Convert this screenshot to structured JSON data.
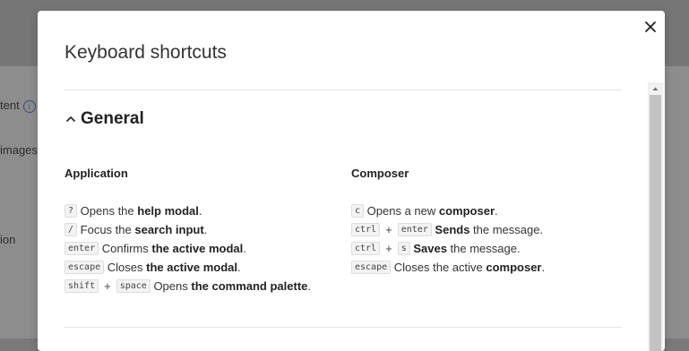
{
  "background": {
    "fragments": [
      "tent",
      "images",
      "ion"
    ]
  },
  "modal": {
    "title": "Keyboard shortcuts",
    "section": {
      "title": "General",
      "expanded": true
    },
    "columns": [
      {
        "title": "Application",
        "shortcuts": [
          {
            "keys": [
              "?"
            ],
            "pre": "Opens the ",
            "bold": "help modal",
            "post": "."
          },
          {
            "keys": [
              "/"
            ],
            "pre": "Focus the ",
            "bold": "search input",
            "post": "."
          },
          {
            "keys": [
              "enter"
            ],
            "pre": "Confirms ",
            "bold": "the active modal",
            "post": "."
          },
          {
            "keys": [
              "escape"
            ],
            "pre": "Closes ",
            "bold": "the active modal",
            "post": "."
          },
          {
            "keys": [
              "shift",
              "space"
            ],
            "pre": "Opens ",
            "bold": "the command palette",
            "post": "."
          }
        ]
      },
      {
        "title": "Composer",
        "shortcuts": [
          {
            "keys": [
              "c"
            ],
            "pre": "Opens a new ",
            "bold": "composer",
            "post": "."
          },
          {
            "keys": [
              "ctrl",
              "enter"
            ],
            "pre": "",
            "bold": "Sends",
            "post": " the message."
          },
          {
            "keys": [
              "ctrl",
              "s"
            ],
            "pre": "",
            "bold": "Saves",
            "post": " the message."
          },
          {
            "keys": [
              "escape"
            ],
            "pre": "Closes the active ",
            "bold": "composer",
            "post": "."
          }
        ]
      }
    ],
    "key_separator": "+"
  },
  "icons": {
    "close": "close-icon",
    "chevron": "chevron-up-icon",
    "info": "info-icon",
    "scroll_up": "scroll-up-arrow-icon"
  },
  "colors": {
    "overlay": "#8d8d8d",
    "modal_bg": "#ffffff",
    "kbd_bg": "#f3f3f3"
  }
}
